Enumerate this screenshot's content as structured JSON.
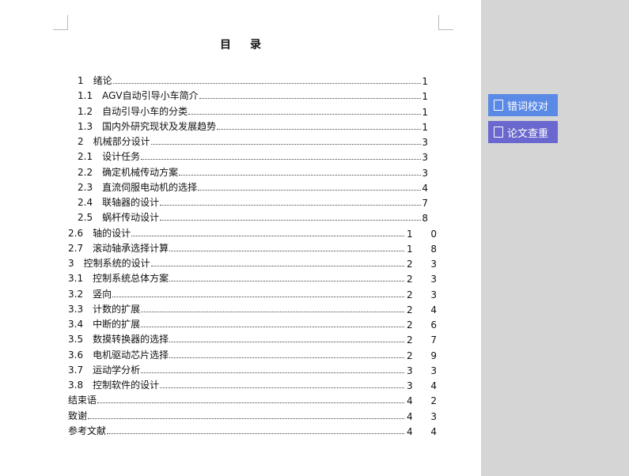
{
  "title": "目录",
  "toc": [
    {
      "label": "1　绪论",
      "page": "1"
    },
    {
      "label": "1.1　AGV自动引导小车简介",
      "page": "1"
    },
    {
      "label": "1.2　自动引导小车的分类",
      "page": "1"
    },
    {
      "label": "1.3　国内外研究现状及发展趋势",
      "page": "1"
    },
    {
      "label": "2　机械部分设计",
      "page": "3"
    },
    {
      "label": "2.1　设计任务",
      "page": "3"
    },
    {
      "label": "2.2　确定机械传动方案",
      "page": "3"
    },
    {
      "label": "2.3　直流伺服电动机的选择",
      "page": "4"
    },
    {
      "label": "2.4　联轴器的设计",
      "page": "7"
    },
    {
      "label": "2.5　蜗杆传动设计",
      "page": "8"
    },
    {
      "label": "2.6　轴的设计",
      "page": "10"
    },
    {
      "label": "2.7　滚动轴承选择计算",
      "page": "18"
    },
    {
      "label": "3　控制系统的设计",
      "page": "23"
    },
    {
      "label": "3.1　控制系统总体方案",
      "page": "23"
    },
    {
      "label": "3.2　竖向",
      "page": "23"
    },
    {
      "label": "3.3　计数的扩展",
      "page": "24"
    },
    {
      "label": "3.4　中断的扩展",
      "page": "26"
    },
    {
      "label": "3.5　数摸转换器的选择",
      "page": "27"
    },
    {
      "label": "3.6　电机驱动芯片选择",
      "page": "29"
    },
    {
      "label": "3.7　运动学分析",
      "page": "33"
    },
    {
      "label": "3.8　控制软件的设计",
      "page": "34"
    },
    {
      "label": "结束语",
      "page": "42"
    },
    {
      "label": "致谢",
      "page": "43"
    },
    {
      "label": "参考文献",
      "page": "44"
    }
  ],
  "side_buttons": {
    "proofread": "错词校对",
    "plagiarism": "论文查重"
  }
}
